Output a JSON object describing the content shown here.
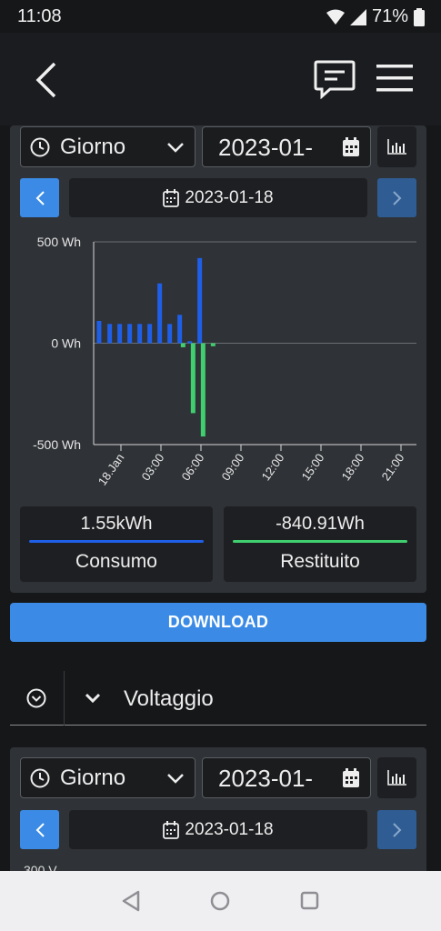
{
  "status_bar": {
    "time": "11:08",
    "battery": "71%"
  },
  "energy_panel": {
    "period_select": "Giorno",
    "date_input": "2023-01-",
    "date_label": "2023-01-18",
    "totals": [
      {
        "value": "1.55kWh",
        "label": "Consumo",
        "color": "#1f5fe8"
      },
      {
        "value": "-840.91Wh",
        "label": "Restituito",
        "color": "#3fcf6f"
      }
    ]
  },
  "download_label": "DOWNLOAD",
  "voltage_section": {
    "title": "Voltaggio"
  },
  "voltage_panel": {
    "period_select": "Giorno",
    "date_input": "2023-01-",
    "date_label": "2023-01-18",
    "y_tick_partial": "300 V"
  },
  "colors": {
    "consumption": "#1f5fe8",
    "returned": "#3fcf6f",
    "accent": "#3b8be6"
  },
  "chart_data": {
    "type": "bar",
    "y_ticks": [
      "500 Wh",
      "0 Wh",
      "-500 Wh"
    ],
    "x_ticks": [
      "18.Jan",
      "03:00",
      "06:00",
      "09:00",
      "12:00",
      "15:00",
      "18:00",
      "21:00"
    ],
    "ylim": [
      -500,
      500
    ],
    "x_range_hours": [
      0,
      24
    ],
    "grid": true,
    "series": [
      {
        "name": "Consumo",
        "color": "#1f5fe8",
        "points": [
          [
            0.2,
            110
          ],
          [
            1.0,
            95
          ],
          [
            1.75,
            95
          ],
          [
            2.5,
            95
          ],
          [
            3.25,
            95
          ],
          [
            4.0,
            95
          ],
          [
            4.75,
            295
          ],
          [
            5.5,
            95
          ],
          [
            6.25,
            140
          ],
          [
            7.0,
            10
          ],
          [
            7.75,
            420
          ]
        ]
      },
      {
        "name": "Restituito",
        "color": "#3fcf6f",
        "points": [
          [
            6.5,
            -20
          ],
          [
            7.25,
            -345
          ],
          [
            8.0,
            -460
          ],
          [
            8.75,
            -15
          ]
        ]
      }
    ]
  }
}
